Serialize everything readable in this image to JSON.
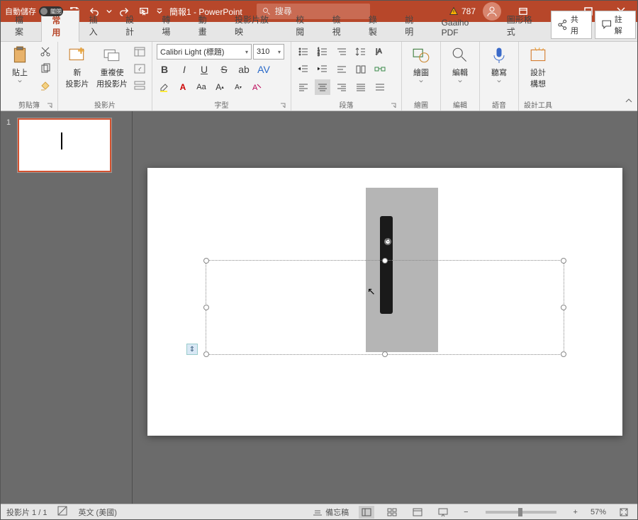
{
  "titlebar": {
    "autosave_label": "自動儲存",
    "autosave_state": "關閉",
    "doc_title": "簡報1 - PowerPoint",
    "search_placeholder": "搜尋",
    "warn_count": "787"
  },
  "tabs": {
    "file": "檔案",
    "home": "常用",
    "insert": "插入",
    "design": "設計",
    "transitions": "轉場",
    "animations": "動畫",
    "slideshow": "投影片放映",
    "review": "校閱",
    "view": "檢視",
    "record": "錄製",
    "help": "說明",
    "gaaiho": "Gaaiho PDF",
    "shapeformat": "圖形格式",
    "share": "共用",
    "comments": "註解"
  },
  "ribbon": {
    "clipboard": {
      "label": "剪貼簿",
      "paste": "貼上"
    },
    "slides": {
      "label": "投影片",
      "new_slide": "新\n投影片",
      "reuse": "重複使\n用投影片"
    },
    "font": {
      "label": "字型",
      "font_name": "Calibri Light (標題)",
      "font_size": "310"
    },
    "paragraph": {
      "label": "段落"
    },
    "drawing": {
      "label": "繪圖",
      "draw": "繪圖"
    },
    "editing": {
      "label": "編輯",
      "edit": "編輯"
    },
    "voice": {
      "label": "語音",
      "dictate": "聽寫"
    },
    "designer": {
      "label": "設計工具",
      "ideas": "設計\n構想"
    }
  },
  "thumbs": {
    "num1": "1"
  },
  "status": {
    "slide_of": "投影片 1 / 1",
    "lang": "英文 (美國)",
    "notes": "備忘稿",
    "zoom": "57%"
  }
}
